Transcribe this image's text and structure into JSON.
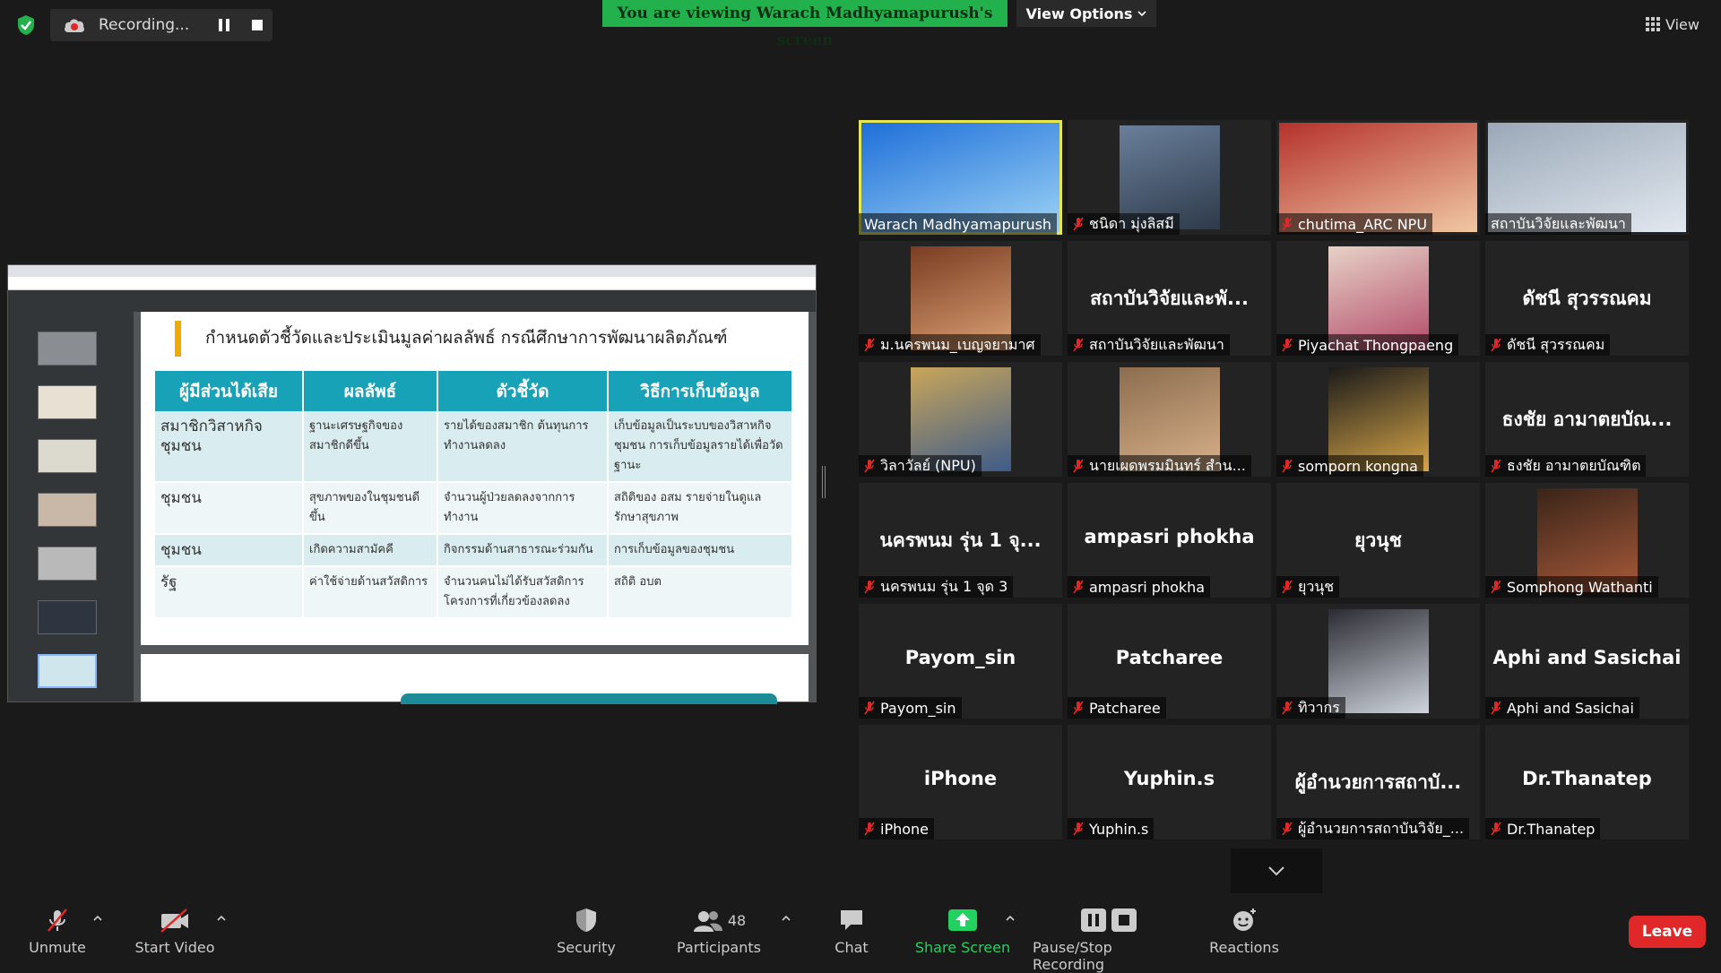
{
  "topbar": {
    "recording_label": "Recording...",
    "viewing_banner": "You are viewing Warach Madhyamapurush's screen",
    "view_options_label": "View Options",
    "view_label": "View"
  },
  "share": {
    "slide_title": "กำหนดตัวชี้วัดและประเมินมูลค่าผลลัพธ์ กรณีศึกษาการพัฒนาผลิตภัณฑ์",
    "table": {
      "headers": [
        "ผู้มีส่วนได้เสีย",
        "ผลลัพธ์",
        "ตัวชี้วัด",
        "วิธีการเก็บข้อมูล"
      ],
      "rows": [
        [
          "สมาชิกวิสาหกิจชุมชน",
          "ฐานะเศรษฐกิจของสมาชิกดีขึ้น",
          "รายได้ของสมาชิก ต้นทุนการทำงานลดลง",
          "เก็บข้อมูลเป็นระบบของวิสาหกิจชุมชน การเก็บข้อมูลรายได้เพื่อวัดฐานะ"
        ],
        [
          "ชุมชน",
          "สุขภาพของในชุมชนดีขึ้น",
          "จำนวนผู้ป่วยลดลงจากการทำงาน",
          "สถิติของ อสม รายจ่ายในดูแลรักษาสุขภาพ"
        ],
        [
          "ชุมชน",
          "เกิดความสามัคคี",
          "กิจกรรมด้านสาธารณะร่วมกัน",
          "การเก็บข้อมูลของชุมชน"
        ],
        [
          "รัฐ",
          "ค่าใช้จ่ายด้านสวัสดิการ",
          "จำนวนคนไม่ได้รับสวัสดิการ โครงการที่เกี่ยวข้องลดลง",
          "สถิติ อบต"
        ]
      ]
    }
  },
  "participants": [
    {
      "big": "",
      "name": "Warach Madhyamapurush",
      "video": true,
      "muted": false,
      "active": true
    },
    {
      "big": "",
      "name": "ชนิดา มุ่งลิสมี",
      "video": true,
      "muted": true
    },
    {
      "big": "",
      "name": "chutima_ARC NPU",
      "video": true,
      "muted": true
    },
    {
      "big": "",
      "name": "สถาบันวิจัยและพัฒนา",
      "video": true,
      "muted": false
    },
    {
      "big": "",
      "name": "ม.นครพนม_เบญจยามาศ",
      "video": true,
      "muted": true
    },
    {
      "big": "สถาบันวิจัยและพั...",
      "name": "สถาบันวิจัยและพัฒนา",
      "video": false,
      "muted": true
    },
    {
      "big": "",
      "name": "Piyachat Thongpaeng",
      "video": true,
      "muted": true
    },
    {
      "big": "ดัชนี สุวรรณคม",
      "name": "ดัชนี สุวรรณคม",
      "video": false,
      "muted": true
    },
    {
      "big": "",
      "name": "วิลาวัลย์ (NPU)",
      "video": true,
      "muted": true
    },
    {
      "big": "",
      "name": "นายเผดพรมมินทร์ สำน...",
      "video": true,
      "muted": true
    },
    {
      "big": "",
      "name": "somporn kongna",
      "video": true,
      "muted": true
    },
    {
      "big": "ธงชัย อามาตยบัณ...",
      "name": "ธงชัย อามาตยบัณฑิต",
      "video": false,
      "muted": true
    },
    {
      "big": "นครพนม รุ่น 1 จุ...",
      "name": "นครพนม รุ่น 1 จุด 3",
      "video": false,
      "muted": true
    },
    {
      "big": "ampasri phokha",
      "name": "ampasri phokha",
      "video": false,
      "muted": true
    },
    {
      "big": "ยุวนุช",
      "name": "ยุวนุช",
      "video": false,
      "muted": true
    },
    {
      "big": "",
      "name": "Somphong Wathanti",
      "video": true,
      "muted": true
    },
    {
      "big": "Payom_sin",
      "name": "Payom_sin",
      "video": false,
      "muted": true
    },
    {
      "big": "Patcharee",
      "name": "Patcharee",
      "video": false,
      "muted": true
    },
    {
      "big": "",
      "name": "ทิวากร",
      "video": true,
      "muted": true
    },
    {
      "big": "Aphi and Sasichai",
      "name": "Aphi and Sasichai",
      "video": false,
      "muted": true
    },
    {
      "big": "iPhone",
      "name": "iPhone",
      "video": false,
      "muted": true
    },
    {
      "big": "Yuphin.s",
      "name": "Yuphin.s",
      "video": false,
      "muted": true
    },
    {
      "big": "ผู้อำนวยการสถาบั...",
      "name": "ผู้อำนวยการสถาบันวิจัย_...",
      "video": false,
      "muted": true
    },
    {
      "big": "Dr.Thanatep",
      "name": "Dr.Thanatep",
      "video": false,
      "muted": true
    }
  ],
  "toolbar": {
    "unmute": "Unmute",
    "start_video": "Start Video",
    "security": "Security",
    "participants": "Participants",
    "participants_count": "48",
    "chat": "Chat",
    "share_screen": "Share Screen",
    "pause_stop_recording": "Pause/Stop Recording",
    "reactions": "Reactions",
    "leave": "Leave"
  },
  "colors": {
    "accent_green": "#23b14d",
    "leave_red": "#e02828",
    "active_speaker": "#e8e84a"
  }
}
